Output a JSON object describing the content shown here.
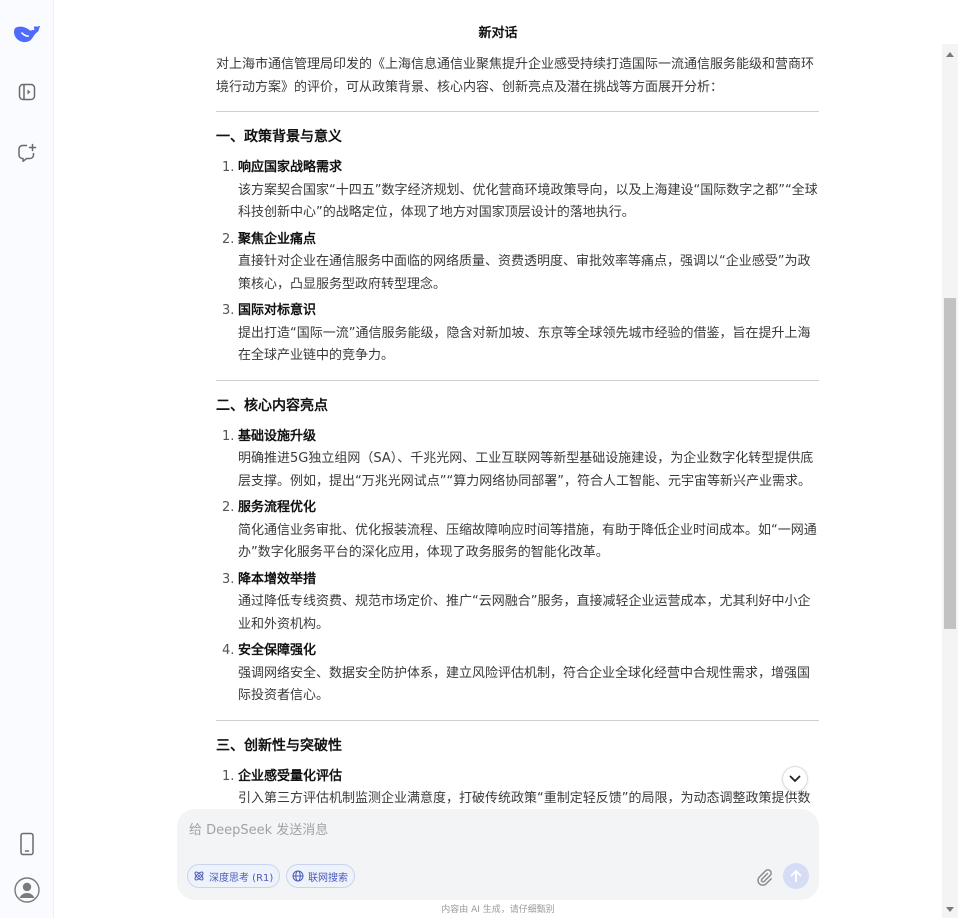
{
  "app": {
    "title": "新对话"
  },
  "sidebar": {
    "icons": [
      "deepseek-logo",
      "expand-sidebar-icon",
      "new-chat-icon",
      "mobile-app-icon",
      "user-avatar"
    ]
  },
  "content": {
    "intro": "对上海市通信管理局印发的《上海信息通信业聚焦提升企业感受持续打造国际一流通信服务能级和营商环境行动方案》的评价，可从政策背景、核心内容、创新亮点及潜在挑战等方面展开分析：",
    "sections": [
      {
        "title": "一、政策背景与意义",
        "items": [
          {
            "num": "1.",
            "head": "响应国家战略需求",
            "desc": "该方案契合国家“十四五”数字经济规划、优化营商环境政策导向，以及上海建设“国际数字之都”“全球科技创新中心”的战略定位，体现了地方对国家顶层设计的落地执行。"
          },
          {
            "num": "2.",
            "head": "聚焦企业痛点",
            "desc": "直接针对企业在通信服务中面临的网络质量、资费透明度、审批效率等痛点，强调以“企业感受”为政策核心，凸显服务型政府转型理念。"
          },
          {
            "num": "3.",
            "head": "国际对标意识",
            "desc": "提出打造“国际一流”通信服务能级，隐含对新加坡、东京等全球领先城市经验的借鉴，旨在提升上海在全球产业链中的竞争力。"
          }
        ]
      },
      {
        "title": "二、核心内容亮点",
        "items": [
          {
            "num": "1.",
            "head": "基础设施升级",
            "desc": "明确推进5G独立组网（SA）、千兆光网、工业互联网等新型基础设施建设，为企业数字化转型提供底层支撑。例如，提出“万兆光网试点”“算力网络协同部署”，符合人工智能、元宇宙等新兴产业需求。"
          },
          {
            "num": "2.",
            "head": "服务流程优化",
            "desc": "简化通信业务审批、优化报装流程、压缩故障响应时间等措施，有助于降低企业时间成本。如“一网通办”数字化服务平台的深化应用，体现了政务服务的智能化改革。"
          },
          {
            "num": "3.",
            "head": "降本增效举措",
            "desc": "通过降低专线资费、规范市场定价、推广“云网融合”服务，直接减轻企业运营成本，尤其利好中小企业和外资机构。"
          },
          {
            "num": "4.",
            "head": "安全保障强化",
            "desc": "强调网络安全、数据安全防护体系，建立风险评估机制，符合企业全球化经营中合规性需求，增强国际投资者信心。"
          }
        ]
      },
      {
        "title": "三、创新性与突破性",
        "items": [
          {
            "num": "1.",
            "head": "企业感受量化评估",
            "desc": "引入第三方评估机制监测企业满意度，打破传统政策“重制定轻反馈”的局限，为动态调整政策提供数据"
          }
        ]
      }
    ]
  },
  "input": {
    "placeholder": "给 DeepSeek 发送消息",
    "deep_think_label": "深度思考 (R1)",
    "web_search_label": "联网搜索"
  },
  "footer": {
    "note": "内容由 AI 生成，请仔细甄别"
  },
  "colors": {
    "accent": "#4d6bfe",
    "chip_bg": "#eef2fb",
    "send_disabled": "#d6dcf5"
  }
}
